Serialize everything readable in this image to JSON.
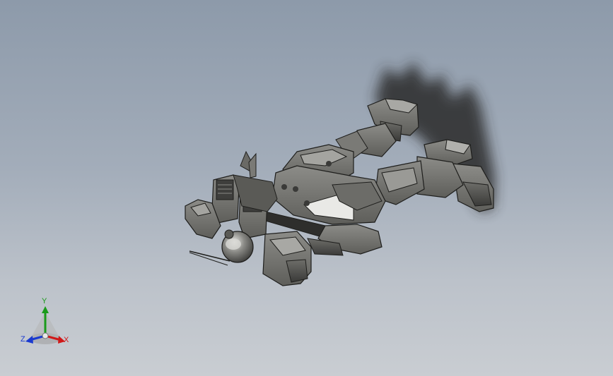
{
  "viewport": {
    "background_top": "#8d9aaa",
    "background_bottom": "#c9cdd2",
    "model": "mecha-robot-assembly"
  },
  "triad": {
    "x_label": "X",
    "y_label": "Y",
    "z_label": "Z",
    "x_color": "#d01818",
    "y_color": "#1a9a1a",
    "z_color": "#1a3ad0"
  }
}
